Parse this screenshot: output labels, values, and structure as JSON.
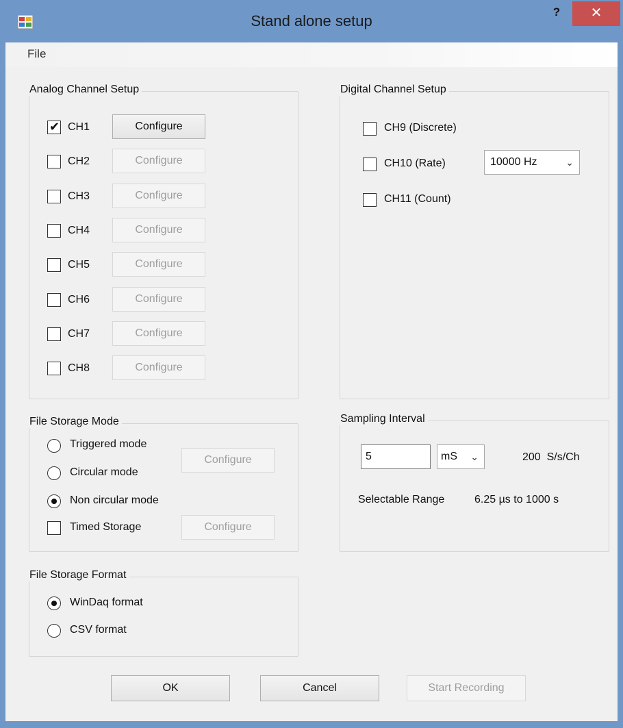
{
  "window": {
    "title": "Stand alone setup",
    "help_label": "?",
    "close_label": "✕"
  },
  "menu": {
    "file_label": "File"
  },
  "analog": {
    "title": "Analog Channel Setup",
    "channels": [
      {
        "label": "CH1",
        "checked": true,
        "button": "Configure",
        "enabled": true
      },
      {
        "label": "CH2",
        "checked": false,
        "button": "Configure",
        "enabled": false
      },
      {
        "label": "CH3",
        "checked": false,
        "button": "Configure",
        "enabled": false
      },
      {
        "label": "CH4",
        "checked": false,
        "button": "Configure",
        "enabled": false
      },
      {
        "label": "CH5",
        "checked": false,
        "button": "Configure",
        "enabled": false
      },
      {
        "label": "CH6",
        "checked": false,
        "button": "Configure",
        "enabled": false
      },
      {
        "label": "CH7",
        "checked": false,
        "button": "Configure",
        "enabled": false
      },
      {
        "label": "CH8",
        "checked": false,
        "button": "Configure",
        "enabled": false
      }
    ]
  },
  "digital": {
    "title": "Digital Channel Setup",
    "channels": [
      {
        "label": "CH9 (Discrete)",
        "checked": false
      },
      {
        "label": "CH10 (Rate)",
        "checked": false
      },
      {
        "label": "CH11 (Count)",
        "checked": false
      }
    ],
    "rate_select": "10000 Hz"
  },
  "storage_mode": {
    "title": "File Storage Mode",
    "triggered": "Triggered mode",
    "circular": "Circular mode",
    "non_circular": "Non circular mode",
    "selected": "non_circular",
    "timed": "Timed Storage",
    "timed_checked": false,
    "configure1": "Configure",
    "configure2": "Configure"
  },
  "sampling": {
    "title": "Sampling Interval",
    "value": "5",
    "unit": "mS",
    "rate_text": "200  S/s/Ch",
    "range_label": "Selectable Range",
    "range_value": "6.25 µs to 1000 s"
  },
  "storage_format": {
    "title": "File Storage Format",
    "winDaq": "WinDaq format",
    "csv": "CSV format",
    "selected": "winDaq"
  },
  "buttons": {
    "ok": "OK",
    "cancel": "Cancel",
    "start": "Start Recording"
  },
  "colors": {
    "title_bar": "#6f97c8",
    "close_button": "#c75050",
    "client_bg": "#f0f0f0"
  }
}
